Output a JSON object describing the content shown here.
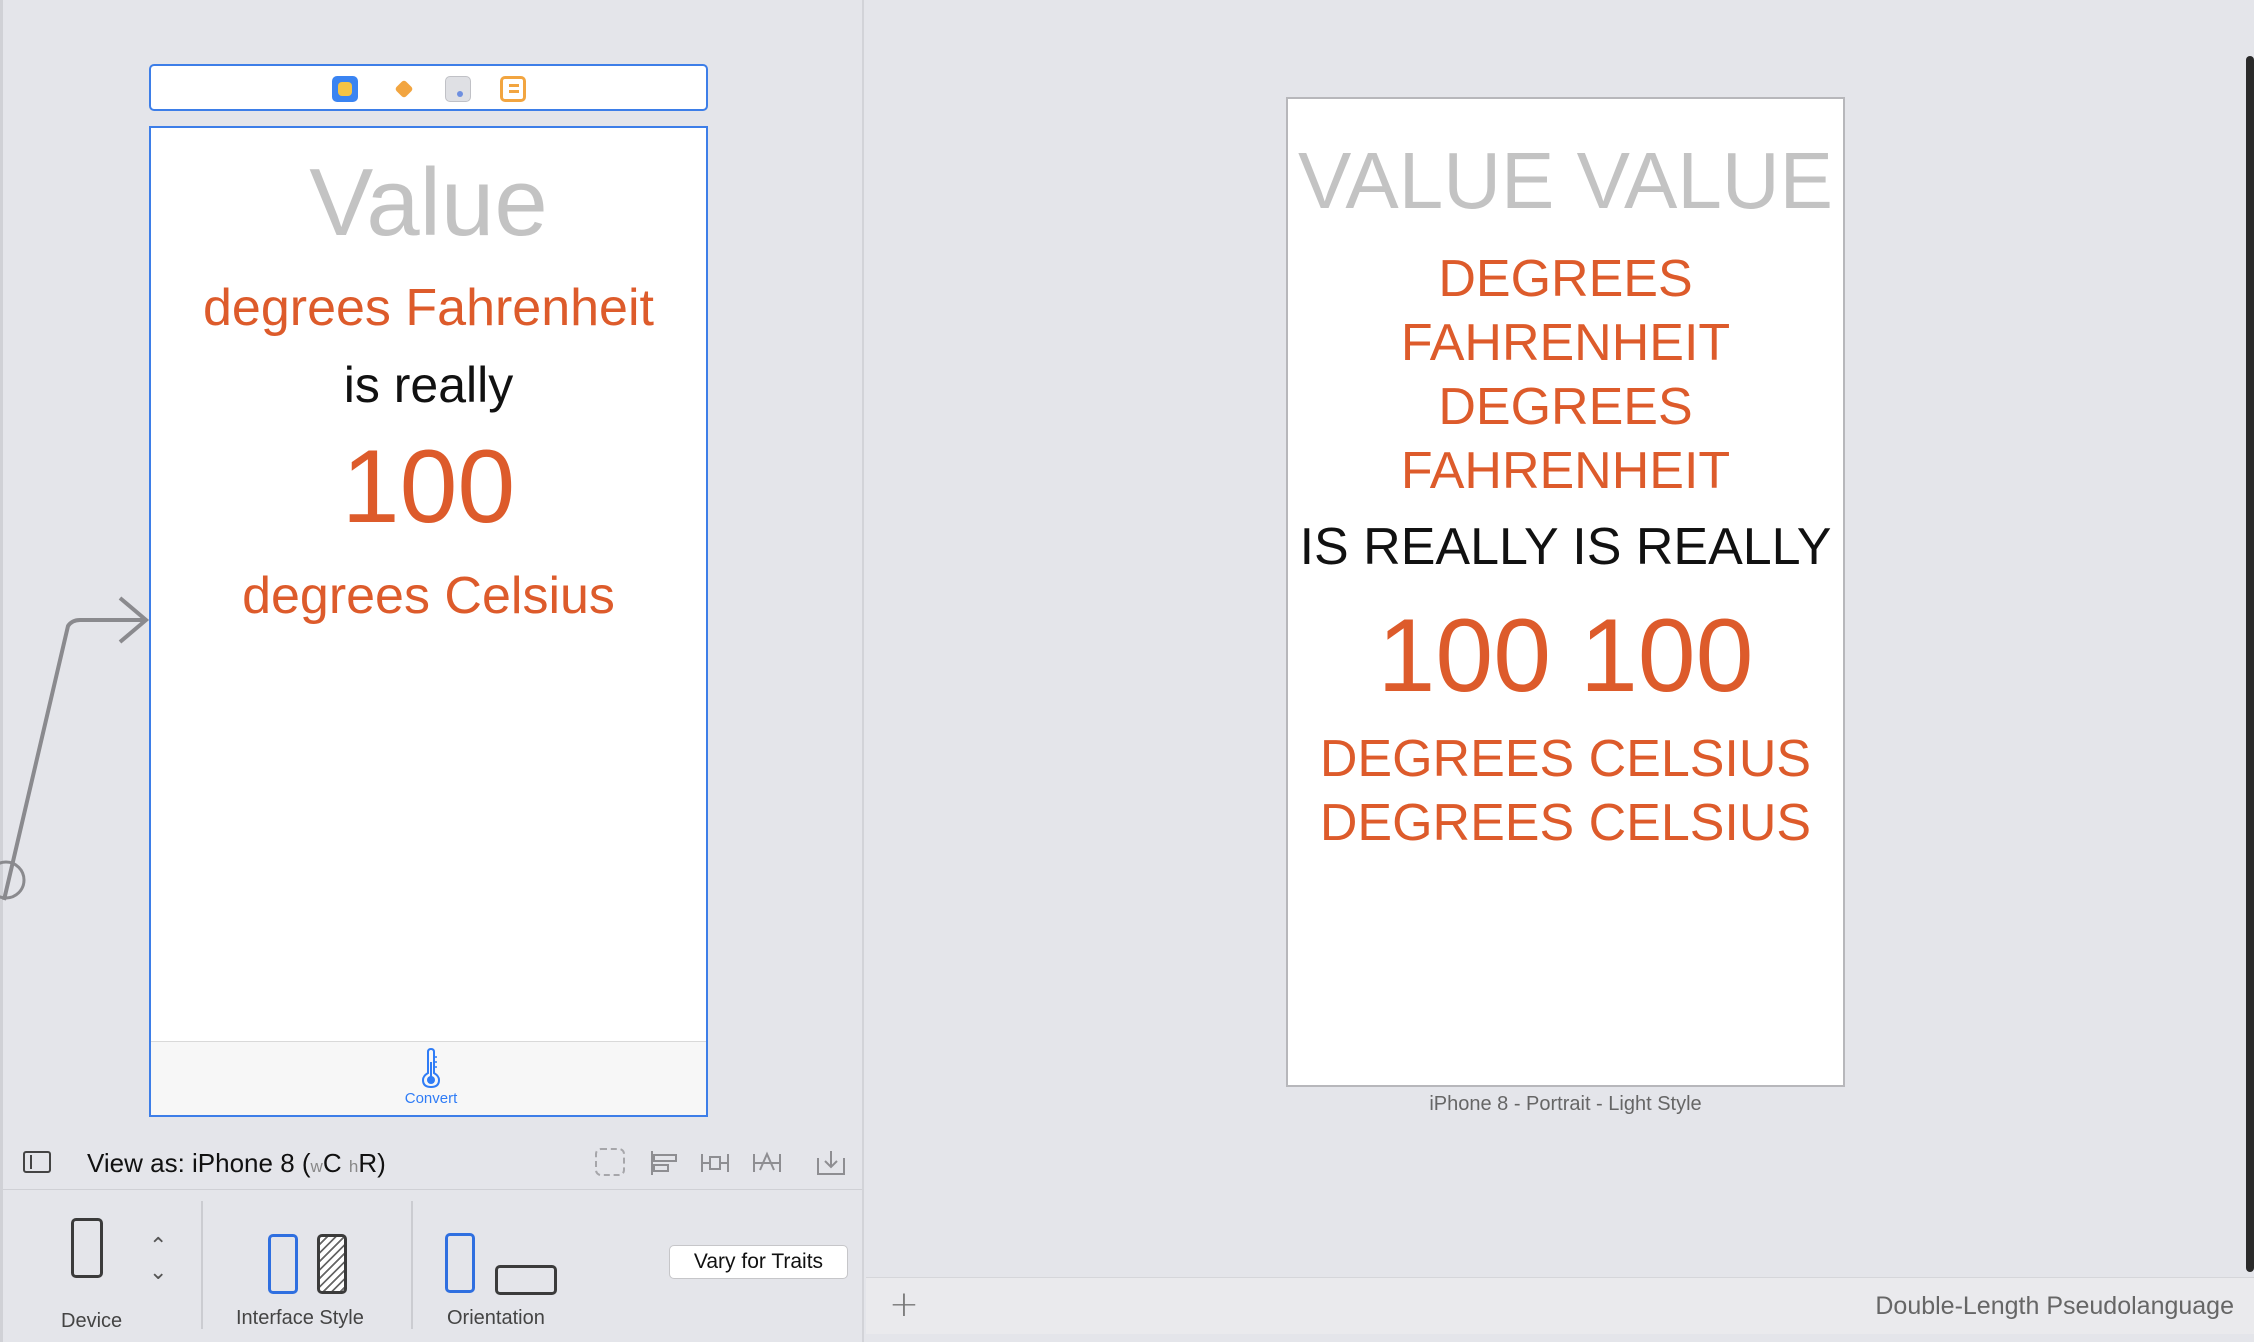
{
  "left_canvas": {
    "scene_dock": {
      "icons": [
        "view-controller-icon",
        "first-responder-icon",
        "exit-icon",
        "storyboard-segue-icon"
      ]
    },
    "scene": {
      "value_label": "Value",
      "fahrenheit_label": "degrees Fahrenheit",
      "is_really_label": "is really",
      "number_label": "100",
      "celsius_label": "degrees Celsius",
      "tab": {
        "icon": "thermometer-icon",
        "label": "Convert"
      }
    }
  },
  "view_as_bar": {
    "label_prefix": "View as: iPhone 8 (",
    "width_class_prefix": "w",
    "width_class": "C",
    "height_class_prefix": "h",
    "height_class": "R",
    "label_suffix": ")"
  },
  "traits_bar": {
    "device_label": "Device",
    "interface_style_label": "Interface Style",
    "orientation_label": "Orientation",
    "vary_button": "Vary for Traits"
  },
  "preview": {
    "value_label": "VALUE VALUE",
    "fahrenheit_line1": "DEGREES",
    "fahrenheit_line2": "FAHRENHEIT",
    "fahrenheit_line3": "DEGREES",
    "fahrenheit_line4": "FAHRENHEIT",
    "is_really_label": "IS REALLY IS REALLY",
    "number_label": "100 100",
    "celsius_line1": "DEGREES CELSIUS",
    "celsius_line2": "DEGREES CELSIUS",
    "caption": "iPhone 8 - Portrait - Light Style",
    "add_button": "+",
    "language": "Double-Length Pseudolanguage"
  },
  "colors": {
    "accent_blue": "#2f7cf6",
    "label_orange": "#dd5b2b",
    "placeholder_gray": "#c3c3c3"
  }
}
